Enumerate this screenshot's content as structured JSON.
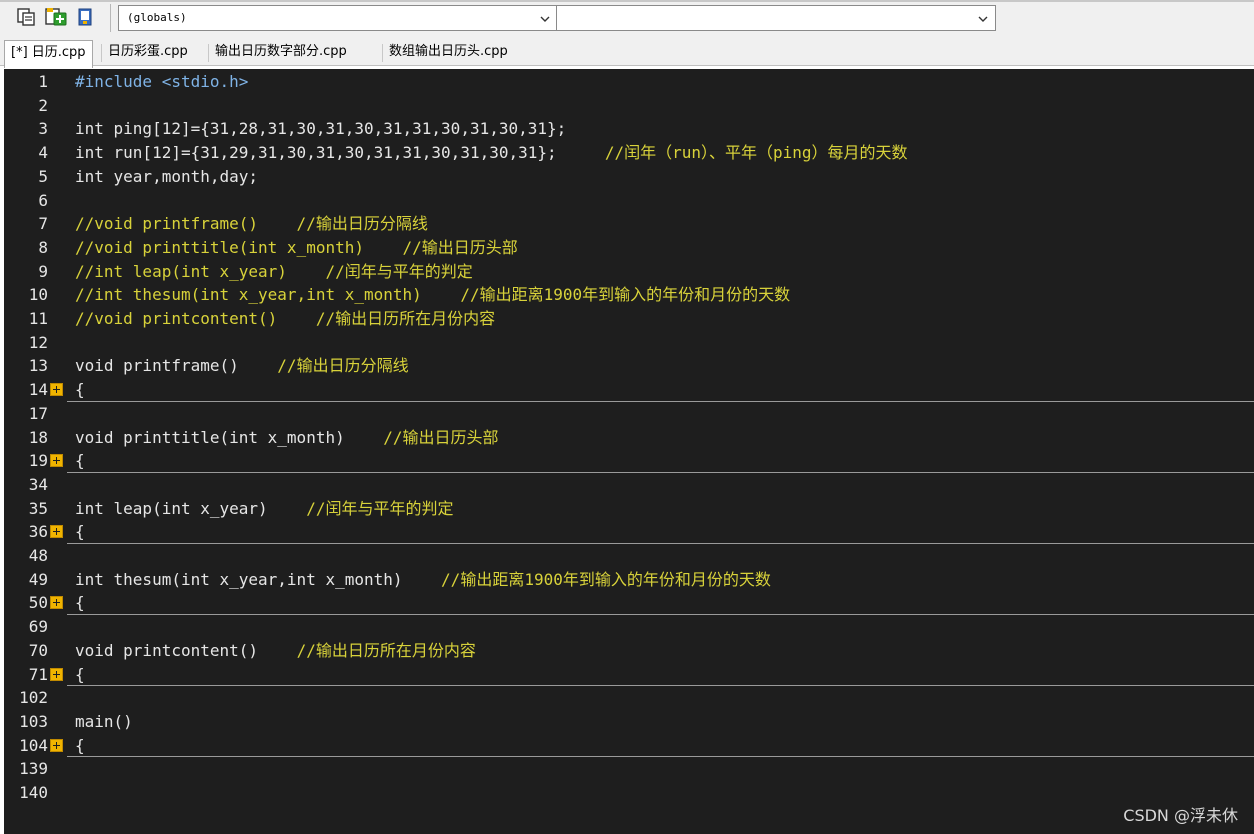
{
  "toolbar": {
    "scope_value": "(globals)",
    "member_value": ""
  },
  "icons": {
    "new_class": "new-class-icon",
    "add_member": "add-member-icon",
    "bookmark": "bookmark-icon",
    "chevron": "chevron-down-icon"
  },
  "tabs": [
    {
      "label": "[*] 日历.cpp",
      "active": true
    },
    {
      "label": "日历彩蛋.cpp"
    },
    {
      "label": "输出日历数字部分.cpp"
    },
    {
      "label": "数组输出日历头.cpp"
    }
  ],
  "editor": {
    "lines": [
      {
        "num": "1",
        "code": "#include <stdio.h>",
        "comment": ""
      },
      {
        "num": "2",
        "code": "",
        "comment": ""
      },
      {
        "num": "3",
        "code": "int ping[12]={31,28,31,30,31,30,31,31,30,31,30,31};",
        "comment": ""
      },
      {
        "num": "4",
        "code": "int run[12]={31,29,31,30,31,30,31,31,30,31,30,31};     ",
        "comment": "//闰年（run）、平年（ping）每月的天数"
      },
      {
        "num": "5",
        "code": "int year,month,day;",
        "comment": ""
      },
      {
        "num": "6",
        "code": "",
        "comment": ""
      },
      {
        "num": "7",
        "code": "",
        "comment": "//void printframe()    //输出日历分隔线"
      },
      {
        "num": "8",
        "code": "",
        "comment": "//void printtitle(int x_month)    //输出日历头部"
      },
      {
        "num": "9",
        "code": "",
        "comment": "//int leap(int x_year)    //闰年与平年的判定"
      },
      {
        "num": "10",
        "code": "",
        "comment": "//int thesum(int x_year,int x_month)    //输出距离1900年到输入的年份和月份的天数"
      },
      {
        "num": "11",
        "code": "",
        "comment": "//void printcontent()    //输出日历所在月份内容"
      },
      {
        "num": "12",
        "code": "",
        "comment": ""
      },
      {
        "num": "13",
        "code": "void printframe()    ",
        "comment": "//输出日历分隔线"
      },
      {
        "num": "14",
        "code": "{",
        "comment": "",
        "fold": true
      },
      {
        "num": "17",
        "code": "",
        "comment": ""
      },
      {
        "num": "18",
        "code": "void printtitle(int x_month)    ",
        "comment": "//输出日历头部"
      },
      {
        "num": "19",
        "code": "{",
        "comment": "",
        "fold": true
      },
      {
        "num": "34",
        "code": "",
        "comment": ""
      },
      {
        "num": "35",
        "code": "int leap(int x_year)    ",
        "comment": "//闰年与平年的判定"
      },
      {
        "num": "36",
        "code": "{",
        "comment": "",
        "fold": true
      },
      {
        "num": "48",
        "code": "",
        "comment": ""
      },
      {
        "num": "49",
        "code": "int thesum(int x_year,int x_month)    ",
        "comment": "//输出距离1900年到输入的年份和月份的天数"
      },
      {
        "num": "50",
        "code": "{",
        "comment": "",
        "fold": true
      },
      {
        "num": "69",
        "code": "",
        "comment": ""
      },
      {
        "num": "70",
        "code": "void printcontent()    ",
        "comment": "//输出日历所在月份内容"
      },
      {
        "num": "71",
        "code": "{",
        "comment": "",
        "fold": true
      },
      {
        "num": "102",
        "code": "",
        "comment": ""
      },
      {
        "num": "103",
        "code": "main()",
        "comment": ""
      },
      {
        "num": "104",
        "code": "{",
        "comment": "",
        "fold": true
      },
      {
        "num": "139",
        "code": "",
        "comment": ""
      },
      {
        "num": "140",
        "code": "",
        "comment": ""
      }
    ]
  },
  "watermark": "CSDN @浮未休",
  "colors": {
    "editor_bg": "#1e1e1e",
    "comment": "#d8d23a",
    "preprocessor": "#7fb3e6",
    "fold_marker": "#f0b400"
  }
}
